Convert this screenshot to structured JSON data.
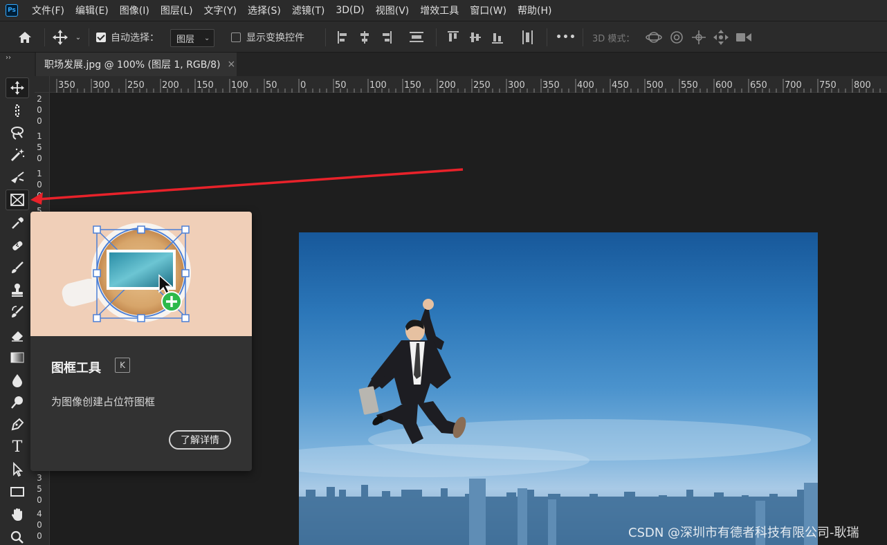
{
  "menubar": {
    "logo": "Ps",
    "items": [
      "文件(F)",
      "编辑(E)",
      "图像(I)",
      "图层(L)",
      "文字(Y)",
      "选择(S)",
      "滤镜(T)",
      "3D(D)",
      "视图(V)",
      "增效工具",
      "窗口(W)",
      "帮助(H)"
    ]
  },
  "options": {
    "auto_select_label": "自动选择：",
    "auto_select_checked": true,
    "auto_select_target": "图层",
    "show_transform_label": "显示变换控件",
    "show_transform_checked": false,
    "more": "•••",
    "mode_3d_label": "3D 模式："
  },
  "document": {
    "tab_title": "职场发展.jpg @ 100% (图层 1, RGB/8)",
    "close": "×"
  },
  "ruler": {
    "top_labels": [
      "350",
      "300",
      "250",
      "200",
      "150",
      "100",
      "50",
      "0",
      "50",
      "100",
      "150",
      "200",
      "250",
      "300",
      "350",
      "400",
      "450",
      "500",
      "550",
      "600",
      "650",
      "700",
      "750",
      "800"
    ],
    "left_groups_top": [
      [
        "2",
        "0",
        "0"
      ],
      [
        "1",
        "5",
        "0"
      ],
      [
        "1",
        "0",
        "0"
      ],
      [
        "5"
      ]
    ],
    "left_groups_bottom": [
      [
        "3",
        "5",
        "0"
      ],
      [
        "4",
        "0",
        "0"
      ]
    ]
  },
  "tooltip": {
    "title": "图框工具",
    "shortcut": "K",
    "description": "为图像创建占位符图框",
    "learn_more": "了解详情"
  },
  "toolbar": {
    "collapse": "››",
    "type_tool_glyph": "T",
    "active_tool": "frame-tool"
  },
  "watermark": "CSDN @深圳市有德者科技有限公司-耿瑞",
  "colors": {
    "accent_arrow": "#e8222a",
    "selection_blue": "#3d7bd9",
    "ps_blue": "#31a8ff"
  }
}
